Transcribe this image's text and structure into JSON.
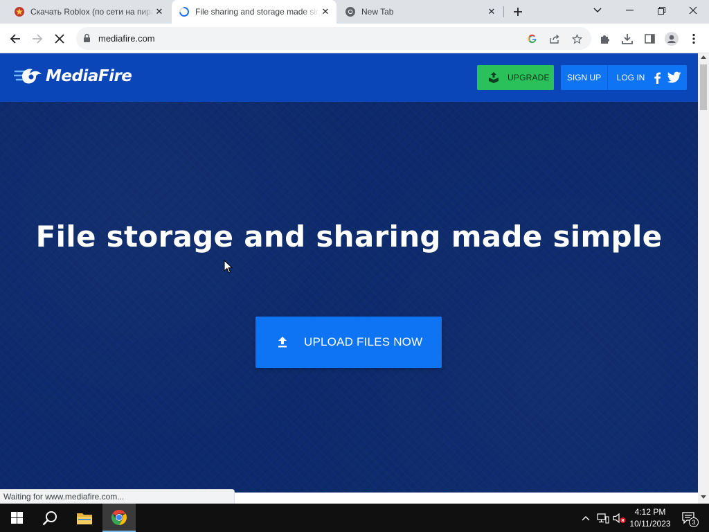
{
  "browser": {
    "tabs": [
      {
        "title": "Скачать Roblox (по сети на пиратке)",
        "favicon": "roblox-site-icon",
        "active": false
      },
      {
        "title": "File sharing and storage made simple",
        "favicon": "loading-spinner-icon",
        "active": true
      },
      {
        "title": "New Tab",
        "favicon": "chrome-icon",
        "active": false
      }
    ],
    "url": "mediafire.com",
    "status_text": "Waiting for www.mediafire.com..."
  },
  "site": {
    "brand": "MediaFire",
    "nav": {
      "upgrade_label": "UPGRADE",
      "signup_label": "SIGN UP",
      "login_label": "LOG IN"
    },
    "hero": {
      "title": "File storage and sharing made simple",
      "upload_label": "UPLOAD FILES NOW"
    }
  },
  "taskbar": {
    "time": "4:12 PM",
    "date": "10/11/2023",
    "notification_count": "3"
  },
  "colors": {
    "header_blue": "#0b46b8",
    "hero_navy": "#0d2a6c",
    "accent_blue": "#0e74f4",
    "upgrade_green": "#2bc15a"
  }
}
